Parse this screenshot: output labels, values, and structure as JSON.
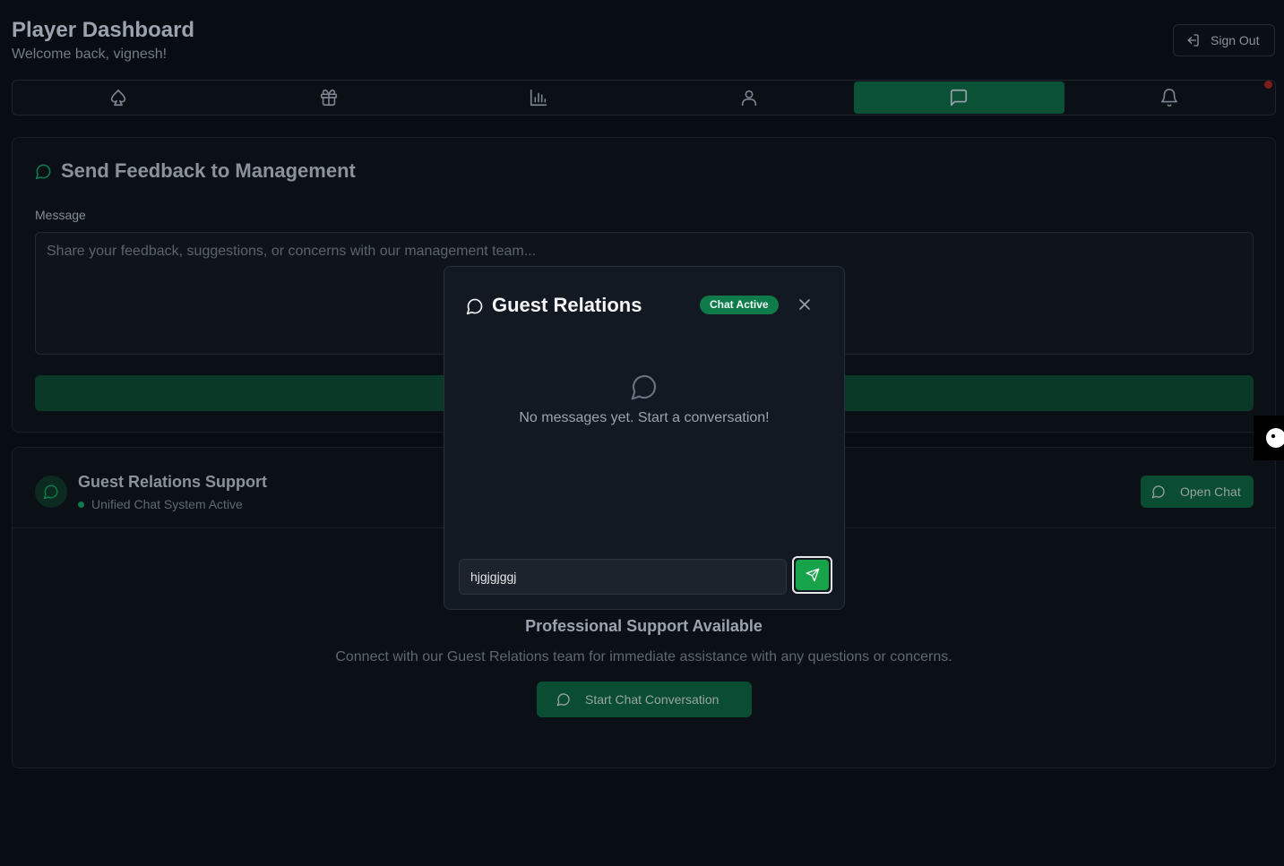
{
  "header": {
    "title": "Player Dashboard",
    "subtitle": "Welcome back, vignesh!",
    "sign_out_label": "Sign Out"
  },
  "tabs": [
    {
      "icon": "spade-icon",
      "active": false
    },
    {
      "icon": "gift-icon",
      "active": false
    },
    {
      "icon": "bar-chart-icon",
      "active": false
    },
    {
      "icon": "user-icon",
      "active": false
    },
    {
      "icon": "message-square-icon",
      "active": true
    },
    {
      "icon": "bell-icon",
      "active": false,
      "has_notification": true
    }
  ],
  "feedback": {
    "title": "Send Feedback to Management",
    "message_label": "Message",
    "message_placeholder": "Share your feedback, suggestions, or concerns with our management team..."
  },
  "support": {
    "title": "Guest Relations Support",
    "status": "Unified Chat System Active",
    "open_chat_label": "Open Chat",
    "pro_title": "Professional Support Available",
    "pro_description": "Connect with our Guest Relations team for immediate assistance with any questions or concerns.",
    "start_chat_label": "Start Chat Conversation"
  },
  "chat_modal": {
    "title": "Guest Relations",
    "badge": "Chat Active",
    "empty_text": "No messages yet. Start a conversation!",
    "input_value": "hjgjgjggj"
  },
  "colors": {
    "accent": "#16a34a",
    "badge": "#0f7a4a",
    "background": "#080c13"
  }
}
